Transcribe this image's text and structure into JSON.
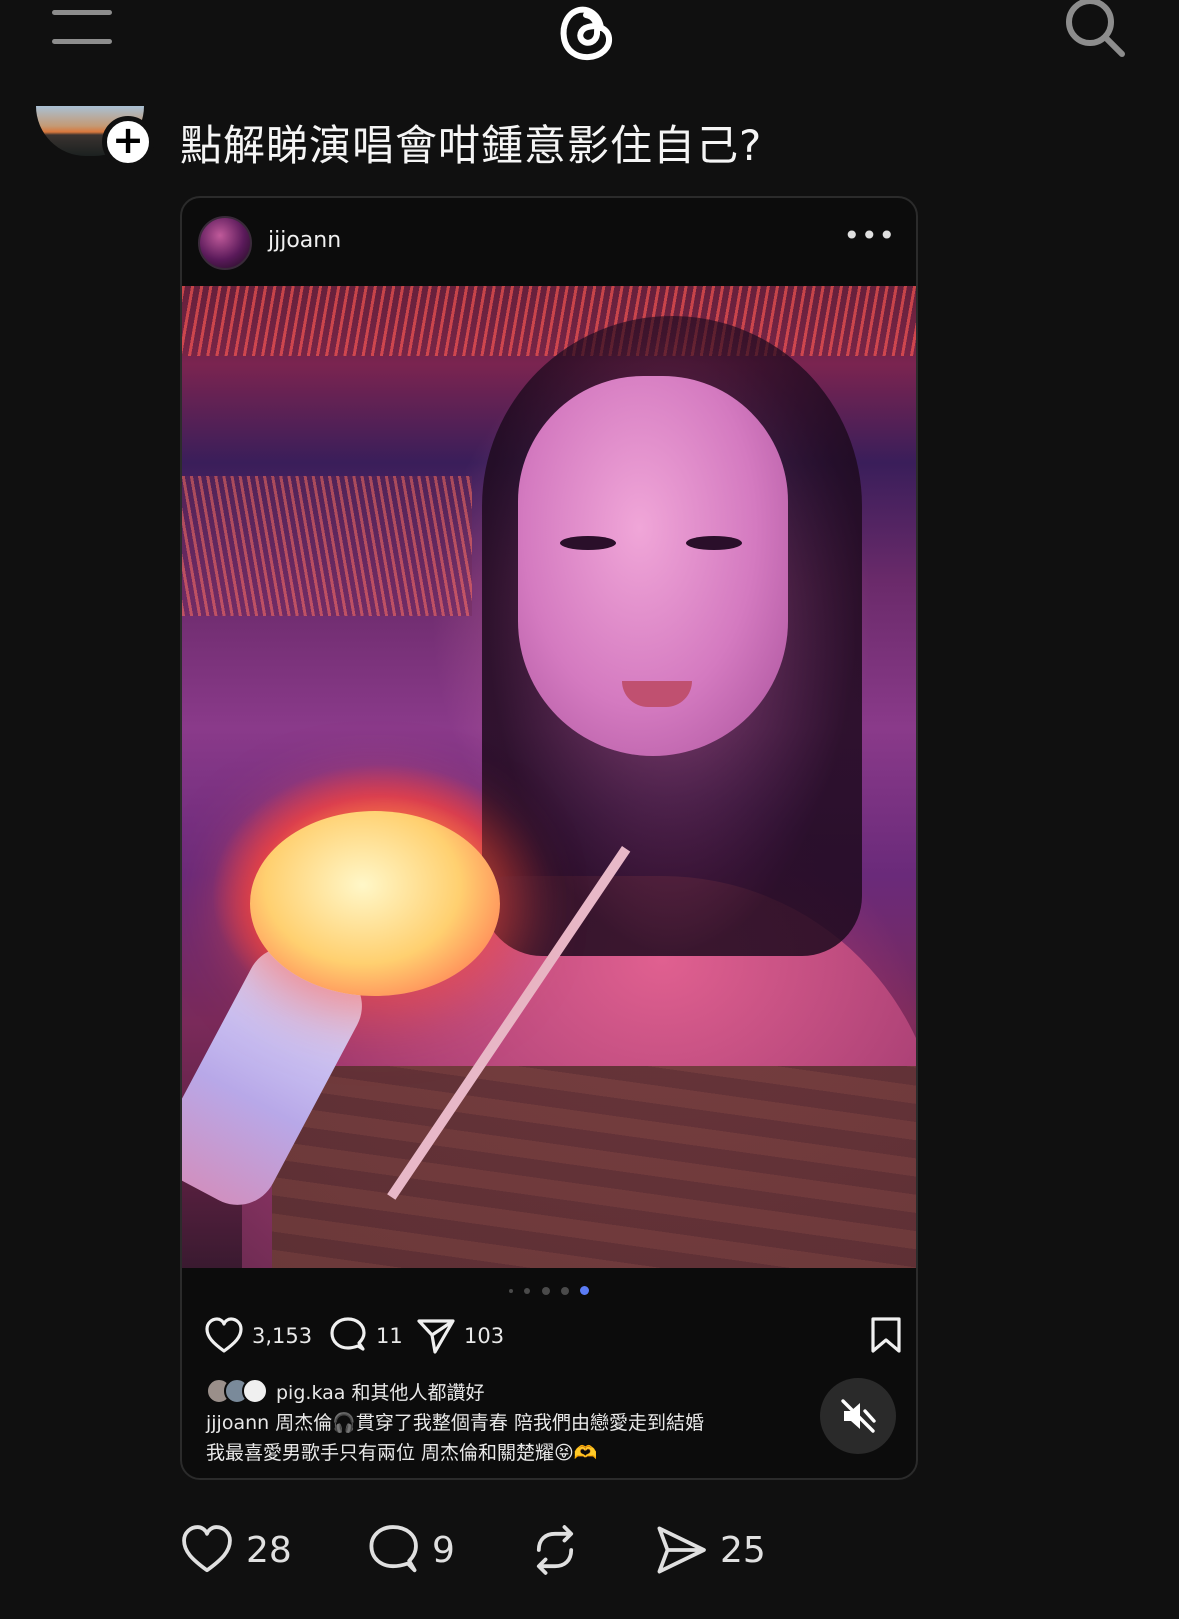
{
  "post": {
    "text": "點解睇演唱會咁鍾意影住自己?",
    "follow_symbol": "+"
  },
  "embed": {
    "username": "jjjoann",
    "more_symbol": "•••",
    "likes": "3,153",
    "comments": "11",
    "shares": "103",
    "liked_by_user": "pig.kaa",
    "liked_by_suffix": "和其他人都讚好",
    "caption_user": "jjjoann",
    "caption_line1": "周杰倫🎧貫穿了我整個青春 陪我們由戀愛走到結婚",
    "caption_line2": "我最喜愛男歌手只有兩位 周杰倫和關楚耀😝🫶"
  },
  "actions": {
    "likes": "28",
    "replies": "9",
    "shares": "25"
  },
  "colors": {
    "background": "#101010",
    "text": "#f3f3f3",
    "icon": "#8d8d8d",
    "active_dot": "#5b7cf5"
  },
  "icons": [
    "menu-icon",
    "threads-logo-icon",
    "search-icon",
    "more-icon",
    "heart-icon",
    "comment-icon",
    "send-icon",
    "bookmark-icon",
    "muted-speaker-icon",
    "repost-icon"
  ]
}
